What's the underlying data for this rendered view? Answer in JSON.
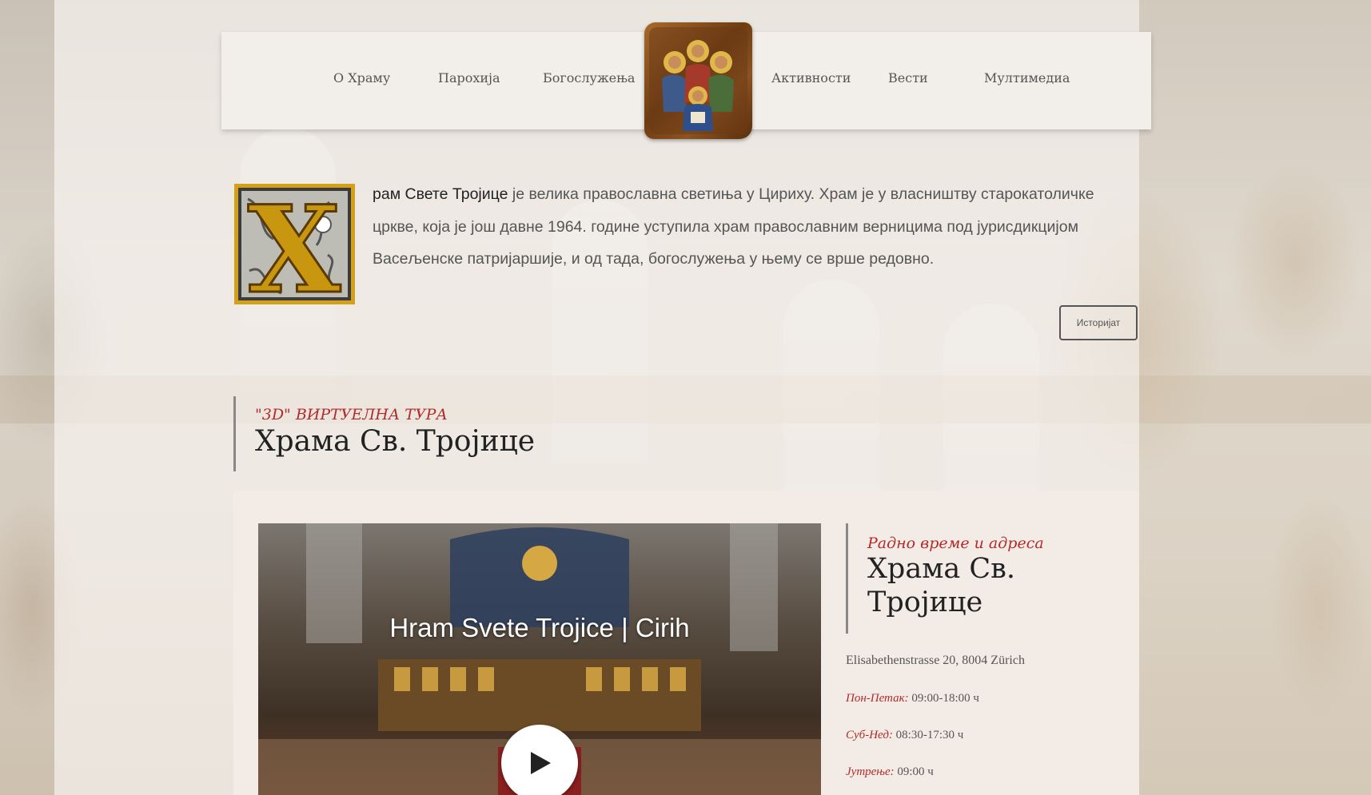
{
  "nav": {
    "items_left": [
      "О Храму",
      "Парохија",
      "Богослужења"
    ],
    "items_right": [
      "Активности",
      "Вести",
      "Мултимедиа"
    ]
  },
  "intro": {
    "dropcap_letter": "Х",
    "lead": "рам Свете Тројице",
    "text": " је велика православна светиња у Цириху. Храм је у власништву старокатоличке цркве, која је још давне 1964. године уступила храм православним верницима под јурисдикцијом Васељенске патријаршије, и од тада, богослужења у њему се врше редовно.",
    "button": "Историјат"
  },
  "tour": {
    "kicker": "\"3D\" ВИРТУЕЛНА ТУРА",
    "title": "Храма Св. Тројице",
    "video_title": "Hram Svete Trojice | Cirih"
  },
  "info": {
    "kicker": "Радно време и адреса",
    "title": "Храма Св. Тројице",
    "address": "Elisabethenstrasse 20, 8004 Zürich",
    "hours": [
      {
        "label": "Пон-Петак:",
        "value": " 09:00-18:00 ч"
      },
      {
        "label": "Суб-Нед:",
        "value": " 08:30-17:30 ч"
      },
      {
        "label": "Јутрење:",
        "value": " 09:00 ч"
      }
    ]
  },
  "colors": {
    "accent": "#b22b2b",
    "text": "#555555",
    "heading": "#222222"
  },
  "icons": [
    "trinity-icon-logo",
    "play-icon"
  ]
}
